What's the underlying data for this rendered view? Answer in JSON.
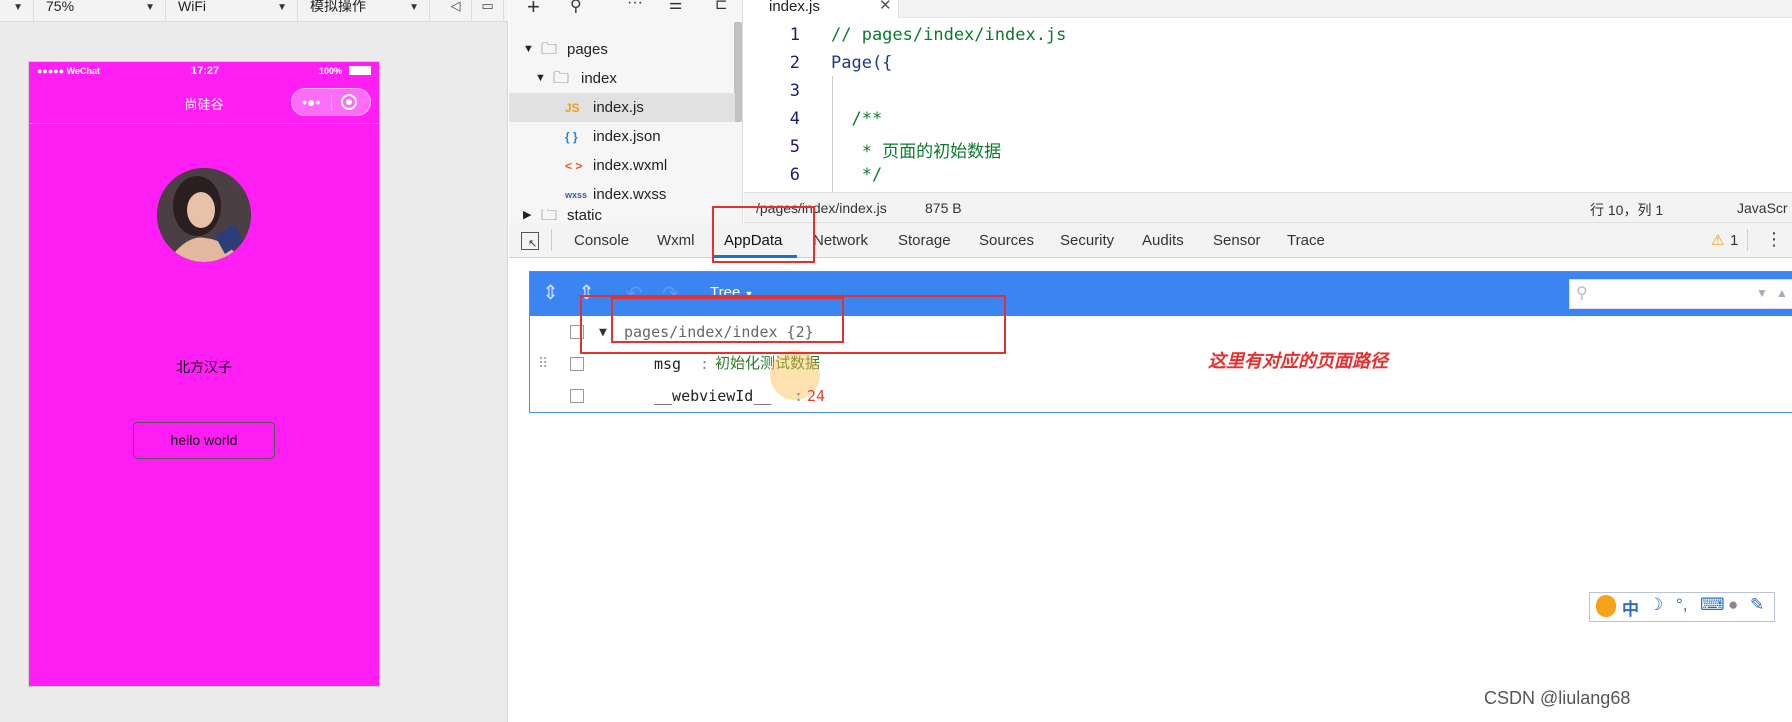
{
  "simulator": {
    "toolbar": {
      "device_partial": "",
      "zoom": "75%",
      "network": "WiFi",
      "operation": "模拟操作"
    },
    "status_bar": {
      "carrier": "●●●●● WeChat",
      "time": "17:27",
      "battery": "100%"
    },
    "nav_title": "尚硅谷",
    "name_text": "北方汉子",
    "button_label": "hello world",
    "background_color": "#ff1ff5"
  },
  "file_tree": {
    "items": [
      {
        "label": "pages",
        "type": "folder"
      },
      {
        "label": "index",
        "type": "folder"
      },
      {
        "label": "index.js",
        "type": "js",
        "badge": "JS"
      },
      {
        "label": "index.json",
        "type": "json",
        "badge": "{ }"
      },
      {
        "label": "index.wxml",
        "type": "wxml",
        "badge": "< >"
      },
      {
        "label": "index.wxss",
        "type": "wxss",
        "badge": "wxss"
      },
      {
        "label": "static",
        "type": "folder"
      }
    ]
  },
  "editor": {
    "tab_label": "index.js",
    "lines": [
      {
        "no": "1",
        "text": "// pages/index/index.js"
      },
      {
        "no": "2",
        "text": "Page({"
      },
      {
        "no": "3",
        "text": ""
      },
      {
        "no": "4",
        "text": "  /**"
      },
      {
        "no": "5",
        "text": "   * 页面的初始数据"
      },
      {
        "no": "6",
        "text": "   */"
      }
    ],
    "status": {
      "path": "/pages/index/index.js",
      "size": "875 B",
      "cursor": "行 10，列 1",
      "language": "JavaScr"
    }
  },
  "devtools": {
    "tabs": [
      "Console",
      "Wxml",
      "AppData",
      "Network",
      "Storage",
      "Sources",
      "Security",
      "Audits",
      "Sensor",
      "Trace"
    ],
    "active_tab": "AppData",
    "warning_count": "1",
    "view_mode": "Tree",
    "data": {
      "root": "pages/index/index {2}",
      "rows": [
        {
          "key": "msg",
          "value": "初始化测试数据",
          "kind": "string"
        },
        {
          "key": "__webviewId__",
          "value": "24",
          "kind": "number"
        }
      ]
    }
  },
  "annotation": "这里有对应的页面路径",
  "ime": {
    "label": "中"
  },
  "watermark": "CSDN @liulang68",
  "colors": {
    "accent": "#3a85f2",
    "highlight_box": "#e53030",
    "active_tab_underline": "#1a6fd8"
  }
}
